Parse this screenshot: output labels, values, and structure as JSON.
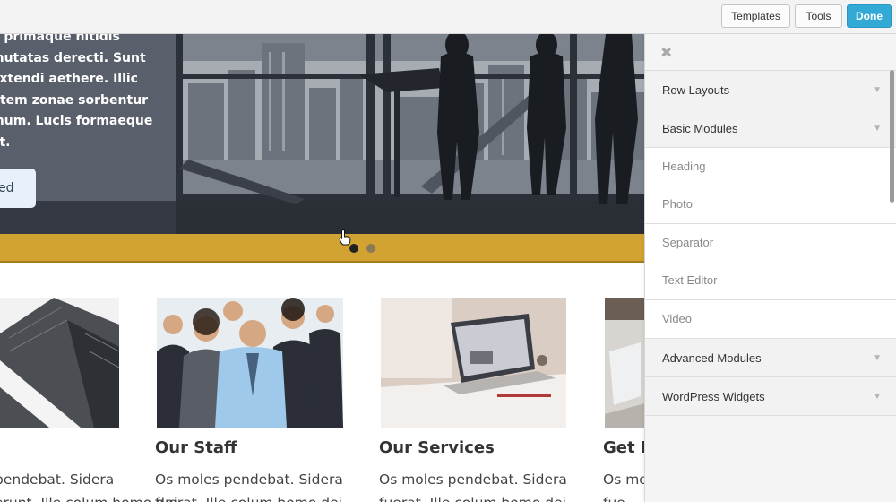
{
  "toolbar": {
    "templates_label": "Templates",
    "tools_label": "Tools",
    "done_label": "Done"
  },
  "hero": {
    "text_lines": [
      "a primaque nitidis",
      "mutatas derecti. Sunt",
      "extendi aethere. Illic",
      "ntem zonae sorbentur",
      "inum. Lucis formaeque",
      "at."
    ],
    "button_label": "ed",
    "slides_count": 2,
    "active_slide": 1
  },
  "cards": [
    {
      "title": "",
      "text_lines": [
        "pendebat. Sidera",
        "erunt. Ille colum homo dei"
      ],
      "image": "skyscraper-photo"
    },
    {
      "title": "Our Staff",
      "text_lines": [
        "Os moles pendebat. Sidera",
        "fuerat. Ille colum homo dei"
      ],
      "image": "team-photo"
    },
    {
      "title": "Our Services",
      "text_lines": [
        "Os moles pendebat. Sidera",
        "fuerat. Ille colum homo dei"
      ],
      "image": "laptop-desk-photo"
    },
    {
      "title": "Get In",
      "text_lines": [
        "Os mo",
        "fue"
      ],
      "image": "office-photo"
    }
  ],
  "panel": {
    "close_icon": "close-icon",
    "rows": [
      {
        "label": "Row Layouts",
        "kind": "section"
      },
      {
        "label": "Basic Modules",
        "kind": "section"
      },
      {
        "label": "Heading",
        "kind": "module"
      },
      {
        "label": "Photo",
        "kind": "module"
      },
      {
        "label": "Separator",
        "kind": "module"
      },
      {
        "label": "Text Editor",
        "kind": "module"
      },
      {
        "label": "Video",
        "kind": "module"
      },
      {
        "label": "Advanced Modules",
        "kind": "section"
      },
      {
        "label": "WordPress Widgets",
        "kind": "section"
      }
    ]
  },
  "colors": {
    "accent_blue": "#33a9d6",
    "band_gold": "#d2a232"
  }
}
